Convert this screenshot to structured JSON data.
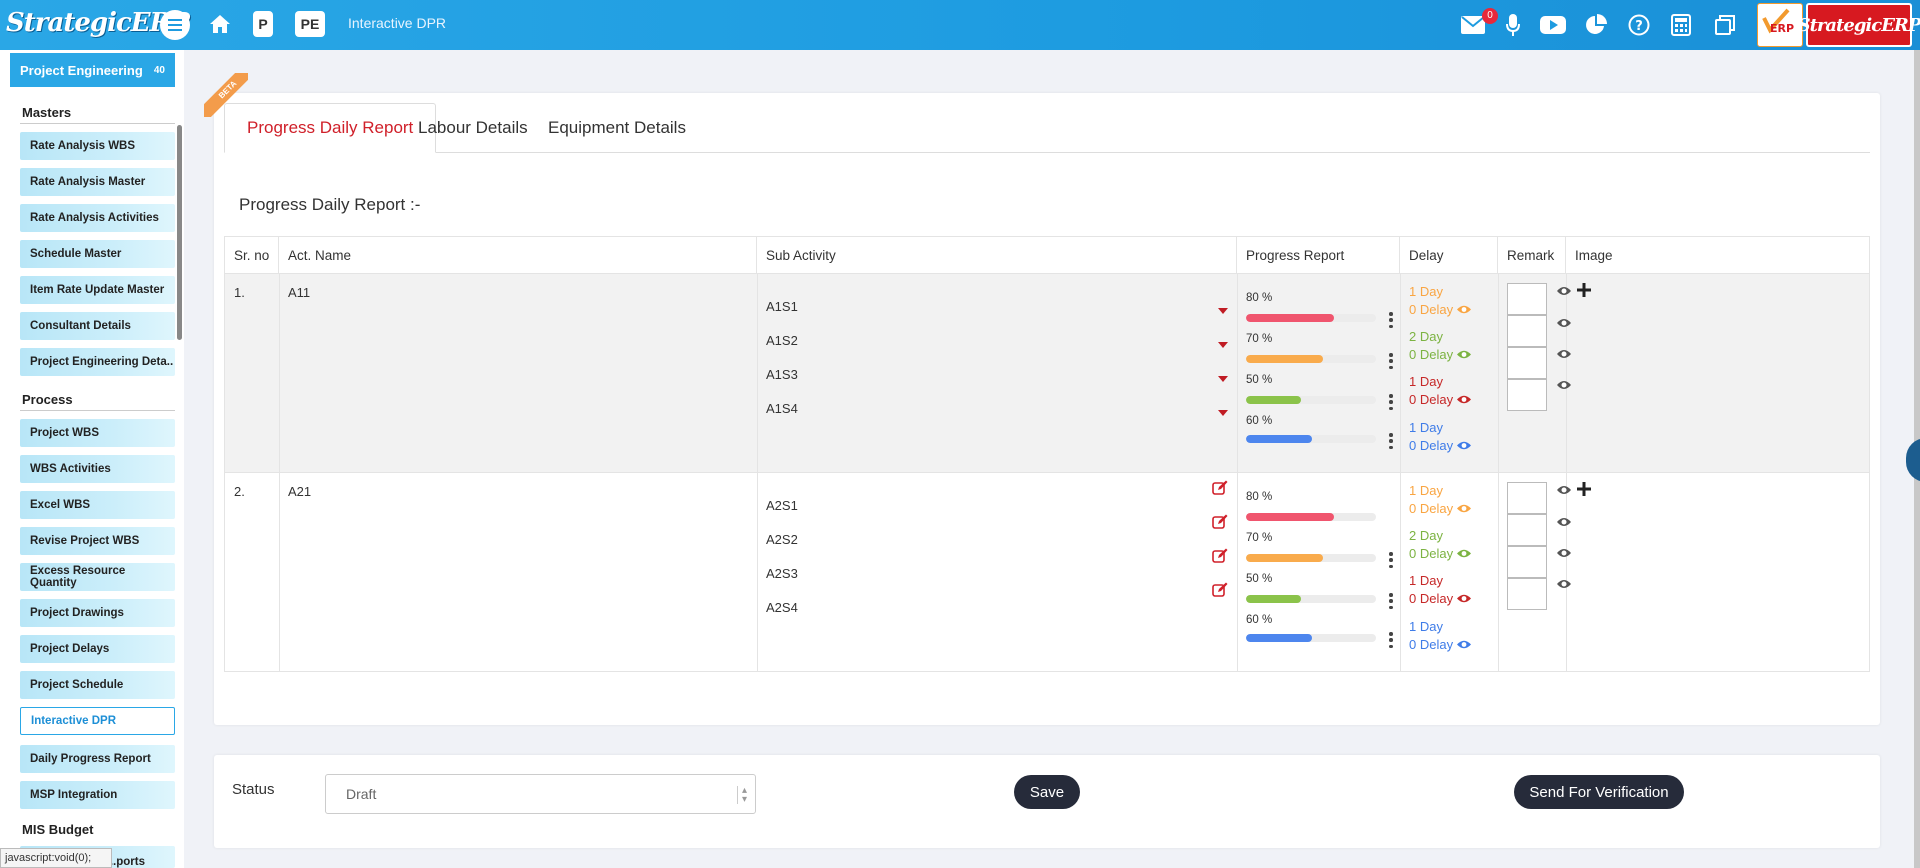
{
  "header": {
    "logo_text": "StrategicERP",
    "btn_p": "P",
    "btn_pe": "PE",
    "page_title": "Interactive DPR",
    "mail_count": "0",
    "brand_right": "StrategicERP"
  },
  "sidebar": {
    "module": "Project Engineering",
    "module_count": "40",
    "sections": {
      "masters": "Masters",
      "process": "Process",
      "mis_budget": "MIS Budget"
    },
    "masters_items": [
      "Rate Analysis WBS",
      "Rate Analysis Master",
      "Rate Analysis Activities",
      "Schedule Master",
      "Item Rate Update Master",
      "Consultant Details",
      "Project Engineering Deta.."
    ],
    "process_items": [
      "Project WBS",
      "WBS Activities",
      "Excel WBS",
      "Revise Project WBS",
      "Excess Resource Quantity",
      "Project Drawings",
      "Project Delays",
      "Project Schedule",
      "Interactive DPR",
      "Daily Progress Report",
      "MSP Integration"
    ],
    "partial_item": "...ports",
    "status_tip": "javascript:void(0);"
  },
  "tabs": [
    "Progress Daily Report",
    "Labour Details",
    "Equipment Details"
  ],
  "report_title": "Progress Daily Report :-",
  "table": {
    "columns": [
      "Sr. no",
      "Act. Name",
      "Sub Activity",
      "Progress Report",
      "Delay",
      "Remark",
      "Image"
    ],
    "rows": [
      {
        "sr": "1.",
        "act": "A11",
        "subs": [
          "A1S1",
          "A1S2",
          "A1S3",
          "A1S4"
        ],
        "progress": [
          {
            "label": "80 %",
            "value": 80,
            "color": "#f0556e"
          },
          {
            "label": "70 %",
            "value": 70,
            "color": "#f9ab4c"
          },
          {
            "label": "50 %",
            "value": 50,
            "color": "#8bc34a"
          },
          {
            "label": "60 %",
            "value": 60,
            "color": "#4d86ee"
          }
        ],
        "delays": [
          {
            "days": "1 Day",
            "delay": "0 Delay",
            "color": "#f9a542"
          },
          {
            "days": "2 Day",
            "delay": "0 Delay",
            "color": "#7cb342"
          },
          {
            "days": "1 Day",
            "delay": "0 Delay",
            "color": "#c62828"
          },
          {
            "days": "1 Day",
            "delay": "0 Delay",
            "color": "#3f7ce8"
          }
        ]
      },
      {
        "sr": "2.",
        "act": "A21",
        "subs": [
          "A2S1",
          "A2S2",
          "A2S3",
          "A2S4"
        ],
        "progress": [
          {
            "label": "80 %",
            "value": 80,
            "color": "#f0556e"
          },
          {
            "label": "70 %",
            "value": 70,
            "color": "#f9ab4c"
          },
          {
            "label": "50 %",
            "value": 50,
            "color": "#8bc34a"
          },
          {
            "label": "60 %",
            "value": 60,
            "color": "#4d86ee"
          }
        ],
        "delays": [
          {
            "days": "1 Day",
            "delay": "0 Delay",
            "color": "#f9a542"
          },
          {
            "days": "2 Day",
            "delay": "0 Delay",
            "color": "#7cb342"
          },
          {
            "days": "1 Day",
            "delay": "0 Delay",
            "color": "#c62828"
          },
          {
            "days": "1 Day",
            "delay": "0 Delay",
            "color": "#3f7ce8"
          }
        ]
      }
    ]
  },
  "footer": {
    "status_label": "Status",
    "status_value": "Draft",
    "save_label": "Save",
    "send_label": "Send For Verification"
  },
  "beta_label": "BETA"
}
